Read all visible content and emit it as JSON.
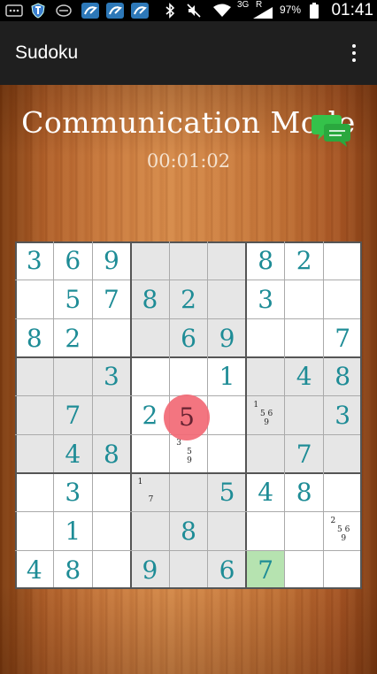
{
  "status_bar": {
    "network_type": "3G",
    "roaming": "R",
    "battery": "97%",
    "time": "01:41"
  },
  "action_bar": {
    "title": "Sudoku",
    "overflow_icon": "more-vert-icon"
  },
  "mode": {
    "title": "Communication Mode",
    "timer": "00:01:02",
    "chat_icon": "chat-bubbles-icon"
  },
  "colors": {
    "digit": "#1e8c96",
    "selected": "#f26a76",
    "highlight_green": "#b6e3b0",
    "shaded_box": "#e6e6e6"
  },
  "grid": {
    "rows": [
      [
        "3",
        "6",
        "9",
        "",
        "",
        "",
        "8",
        "2",
        ""
      ],
      [
        "",
        "5",
        "7",
        "8",
        "2",
        "",
        "3",
        "",
        ""
      ],
      [
        "8",
        "2",
        "",
        "",
        "6",
        "9",
        "",
        "",
        "7"
      ],
      [
        "",
        "",
        "3",
        "",
        "",
        "1",
        "",
        "4",
        "8"
      ],
      [
        "",
        "7",
        "",
        "2",
        "5",
        "",
        "",
        "",
        "3"
      ],
      [
        "",
        "4",
        "8",
        "",
        "",
        "",
        "",
        "7",
        ""
      ],
      [
        "",
        "3",
        "",
        "",
        "",
        "5",
        "4",
        "8",
        ""
      ],
      [
        "",
        "1",
        "",
        "",
        "8",
        "",
        "",
        "",
        ""
      ],
      [
        "4",
        "8",
        "",
        "9",
        "",
        "6",
        "7",
        "",
        ""
      ]
    ],
    "notes": [
      {
        "row": 4,
        "col": 6,
        "lines": [
          "1",
          "5 6",
          "9"
        ]
      },
      {
        "row": 5,
        "col": 4,
        "lines": [
          "3",
          "5",
          "9"
        ]
      },
      {
        "row": 6,
        "col": 3,
        "lines": [
          "1",
          "",
          "7"
        ]
      },
      {
        "row": 7,
        "col": 8,
        "lines": [
          "2",
          "5 6",
          "9"
        ]
      }
    ],
    "selected_cell": {
      "row": 4,
      "col": 4,
      "value": "5"
    },
    "highlighted_cell": {
      "row": 8,
      "col": 6
    }
  }
}
